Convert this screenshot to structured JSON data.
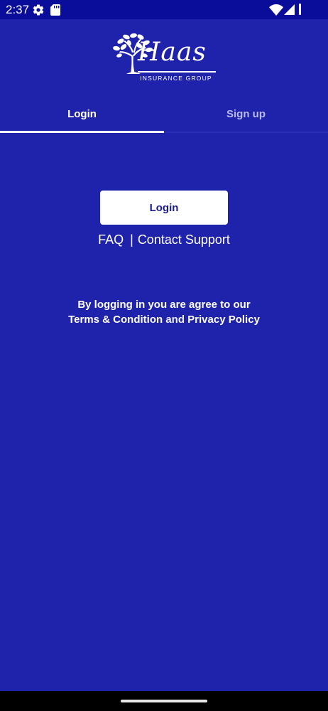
{
  "status_bar": {
    "time": "2:37",
    "icons": [
      "gear-icon",
      "sd-card-icon",
      "wifi-icon",
      "signal-icon",
      "battery-icon"
    ]
  },
  "logo": {
    "name": "Haas",
    "subtitle": "INSURANCE GROUP"
  },
  "tabs": [
    {
      "label": "Login",
      "active": true
    },
    {
      "label": "Sign up",
      "active": false
    }
  ],
  "login_button": {
    "label": "Login"
  },
  "links": {
    "faq": "FAQ",
    "separator": "|",
    "contact": "Contact Support"
  },
  "agreement": {
    "line1": "By logging in you are agree to our",
    "terms": "Terms & Condition",
    "and": "and",
    "privacy": "Privacy Policy"
  },
  "colors": {
    "background": "#1f22ab",
    "status_bar": "#0a0d99",
    "button_background": "#ffffff",
    "button_text": "#1a1d8c",
    "inactive_tab": "#b9bbec"
  }
}
